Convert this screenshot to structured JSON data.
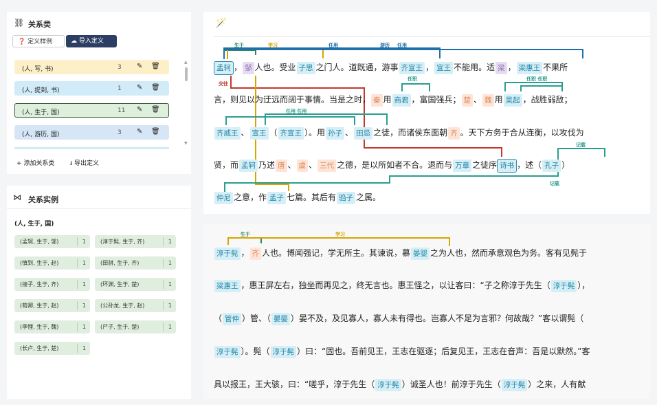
{
  "sidebar": {
    "relation_types": {
      "title": "关系类",
      "example_btn": "定义样例",
      "import_btn": "导入定义",
      "definitions": [
        {
          "label": "(人, 写, 书)",
          "count": "3",
          "color": "#fdf0c8",
          "border": "#fdf0c8"
        },
        {
          "label": "(人, 提到, 书)",
          "count": "1",
          "color": "#d2ebf8",
          "border": "#d2ebf8"
        },
        {
          "label": "(人, 生于, 国)",
          "count": "11",
          "color": "#ddf0dc",
          "border": "#3c5a3f"
        },
        {
          "label": "(人, 游历, 国)",
          "count": "3",
          "color": "#d6e6f6",
          "border": "#d6e6f6"
        }
      ],
      "add_btn": "添加关系类",
      "export_btn": "导出定义"
    },
    "relation_instances": {
      "title": "关系实例",
      "current": "(人, 生于, 国)",
      "items": [
        {
          "label": "(孟轲, 生于, 邹)",
          "count": "1"
        },
        {
          "label": "(淳于髡, 生于, 齐)",
          "count": "1"
        },
        {
          "label": "(慎到, 生于, 赵)",
          "count": "1"
        },
        {
          "label": "(田骈, 生于, 齐)",
          "count": "1"
        },
        {
          "label": "(接子, 生于, 齐)",
          "count": "1"
        },
        {
          "label": "(环渊, 生于, 楚)",
          "count": "1"
        },
        {
          "label": "(荀卿, 生于, 赵)",
          "count": "1"
        },
        {
          "label": "(公孙龙, 生于, 赵)",
          "count": "1"
        },
        {
          "label": "(李悝, 生于, 魏)",
          "count": "1"
        },
        {
          "label": "(尸子, 生于, 楚)",
          "count": "1"
        },
        {
          "label": "(长卢, 生于, 楚)",
          "count": "1"
        }
      ]
    }
  },
  "doc1": {
    "lines": [
      [
        [
          "p",
          "孟轲",
          "sel"
        ],
        [
          "t",
          "，"
        ],
        [
          "b",
          "邹"
        ],
        [
          "t",
          "人也。受业"
        ],
        [
          "p",
          "子思"
        ],
        [
          "t",
          "之门人。道既通，游事"
        ],
        [
          "p",
          "齐宣王"
        ],
        [
          "t",
          "，"
        ],
        [
          "p",
          "宣王"
        ],
        [
          "t",
          "不能用。适"
        ],
        [
          "b",
          "梁"
        ],
        [
          "t",
          "，"
        ],
        [
          "p",
          "梁惠王"
        ],
        [
          "t",
          "不果所"
        ]
      ],
      [
        [
          "t",
          "言，则见以为迂远而阔于事情。当是之时，"
        ],
        [
          "l",
          "秦"
        ],
        [
          "t",
          "用"
        ],
        [
          "p",
          "商君"
        ],
        [
          "t",
          "，富国强兵；"
        ],
        [
          "l",
          "楚"
        ],
        [
          "t",
          "、"
        ],
        [
          "l",
          "魏"
        ],
        [
          "t",
          "用"
        ],
        [
          "p",
          "吴起"
        ],
        [
          "t",
          "，战胜弱敌；"
        ]
      ],
      [
        [
          "p",
          "齐威王"
        ],
        [
          "t",
          "、"
        ],
        [
          "p",
          "宣王"
        ],
        [
          "t",
          "（"
        ],
        [
          "p",
          "齐宣王"
        ],
        [
          "t",
          "）。用"
        ],
        [
          "p",
          "孙子"
        ],
        [
          "t",
          "、"
        ],
        [
          "p",
          "田忌"
        ],
        [
          "t",
          "之徒，而诸侯东面朝"
        ],
        [
          "l",
          "齐"
        ],
        [
          "t",
          "。天下方务于合从连衡，以攻伐为"
        ]
      ],
      [
        [
          "t",
          "贤，而"
        ],
        [
          "p",
          "孟轲"
        ],
        [
          "t",
          "乃述"
        ],
        [
          "l",
          "唐"
        ],
        [
          "t",
          "、"
        ],
        [
          "l",
          "虞"
        ],
        [
          "t",
          "、"
        ],
        [
          "l",
          "三代"
        ],
        [
          "t",
          "之德，是以所如者不合。退而与"
        ],
        [
          "p",
          "万章"
        ],
        [
          "t",
          "之徒序"
        ],
        [
          "p",
          "诗书",
          "sel"
        ],
        [
          "t",
          "，述（"
        ],
        [
          "p",
          "孔子"
        ],
        [
          "t",
          "）"
        ]
      ],
      [
        [
          "p",
          "仲尼"
        ],
        [
          "t",
          "之意，作"
        ],
        [
          "p",
          "孟子"
        ],
        [
          "t",
          "七篇。其后有"
        ],
        [
          "p",
          "驺子"
        ],
        [
          "t",
          "之属。"
        ]
      ]
    ],
    "labels": {
      "born": "生于",
      "study": "学习",
      "appoint": "任用",
      "travel": "游历",
      "cross": "交往",
      "official": "任职",
      "official2": "任职 任职",
      "appoint2": "任用 任用",
      "record": "记载",
      "record2": "记载"
    }
  },
  "doc2": {
    "lines": [
      [
        [
          "p",
          "淳于髡"
        ],
        [
          "t",
          "，"
        ],
        [
          "l",
          "齐"
        ],
        [
          "t",
          "人也。博闻强记，学无所主。其谏说，慕"
        ],
        [
          "p",
          "晏婴"
        ],
        [
          "t",
          "之为人也，然而承意观色为务。客有见髡于"
        ]
      ],
      [
        [
          "p",
          "梁惠王"
        ],
        [
          "t",
          "，惠王屏左右，独坐而再见之，终无言也。惠王怪之，以让客曰：“子之称淳于先生（"
        ],
        [
          "p",
          "淳于髡"
        ],
        [
          "t",
          "），"
        ]
      ],
      [
        [
          "t",
          "（"
        ],
        [
          "p",
          "管仲"
        ],
        [
          "t",
          "）管、（"
        ],
        [
          "p",
          "晏婴"
        ],
        [
          "t",
          "）晏不及，及见寡人，寡人未有得也。岂寡人不足为言邪？何故哉？”客以谓髡（"
        ]
      ],
      [
        [
          "p",
          "淳于髡"
        ],
        [
          "t",
          "）。髡（"
        ],
        [
          "p",
          "淳于髡"
        ],
        [
          "t",
          "）曰：“固也。吾前见王，王志在驱逐；后复见王，王志在音声：吾是以默然。”客"
        ]
      ],
      [
        [
          "t",
          "具以报王，王大骇，曰：“嗟乎，淳于先生（"
        ],
        [
          "p",
          "淳于髡"
        ],
        [
          "t",
          "）诚圣人也！前淳于先生（"
        ],
        [
          "p",
          "淳于髡"
        ],
        [
          "t",
          "）之来，人有献"
        ]
      ]
    ],
    "labels": {
      "born": "生于",
      "study": "学习"
    }
  }
}
